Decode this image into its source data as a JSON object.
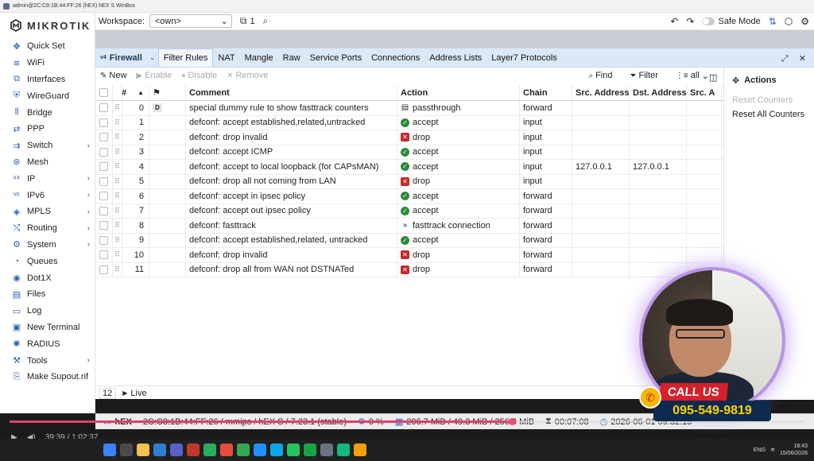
{
  "window": {
    "title": "admin@2C:C8:1B:44:FF:26 (hEX) hEX S WinBox"
  },
  "brand": {
    "logo_text": "MIKROTIK"
  },
  "sidebar": {
    "items": [
      {
        "label": "Quick Set",
        "icon": "quick-set-icon",
        "glyph": "✥",
        "chevron": false
      },
      {
        "label": "WiFi",
        "icon": "wifi-icon",
        "glyph": "≋",
        "chevron": false
      },
      {
        "label": "Interfaces",
        "icon": "interfaces-icon",
        "glyph": "⧉",
        "chevron": false
      },
      {
        "label": "WireGuard",
        "icon": "wireguard-icon",
        "glyph": "⛨",
        "chevron": false
      },
      {
        "label": "Bridge",
        "icon": "bridge-icon",
        "glyph": "⫴",
        "chevron": false
      },
      {
        "label": "PPP",
        "icon": "ppp-icon",
        "glyph": "⇄",
        "chevron": false
      },
      {
        "label": "Switch",
        "icon": "switch-icon",
        "glyph": "⇉",
        "chevron": true
      },
      {
        "label": "Mesh",
        "icon": "mesh-icon",
        "glyph": "⊛",
        "chevron": false
      },
      {
        "label": "IP",
        "icon": "ip-icon",
        "glyph": "ᵛ⁴",
        "chevron": true
      },
      {
        "label": "IPv6",
        "icon": "ipv6-icon",
        "glyph": "ᵛ⁶",
        "chevron": true
      },
      {
        "label": "MPLS",
        "icon": "mpls-icon",
        "glyph": "◈",
        "chevron": true
      },
      {
        "label": "Routing",
        "icon": "routing-icon",
        "glyph": "⤭",
        "chevron": true
      },
      {
        "label": "System",
        "icon": "system-icon",
        "glyph": "⚙",
        "chevron": true
      },
      {
        "label": "Queues",
        "icon": "queues-icon",
        "glyph": "◔",
        "chevron": false
      },
      {
        "label": "Dot1X",
        "icon": "dot1x-icon",
        "glyph": "◉",
        "chevron": false
      },
      {
        "label": "Files",
        "icon": "files-icon",
        "glyph": "▤",
        "chevron": false
      },
      {
        "label": "Log",
        "icon": "log-icon",
        "glyph": "▭",
        "chevron": false
      },
      {
        "label": "New Terminal",
        "icon": "terminal-icon",
        "glyph": "▣",
        "chevron": false
      },
      {
        "label": "RADIUS",
        "icon": "radius-icon",
        "glyph": "✺",
        "chevron": false
      },
      {
        "label": "Tools",
        "icon": "tools-icon",
        "glyph": "⚒",
        "chevron": true
      },
      {
        "label": "Make Supout.rif",
        "icon": "supout-icon",
        "glyph": "⎘",
        "chevron": false
      }
    ]
  },
  "topbar": {
    "workspace_label": "Workspace:",
    "workspace_value": "<own>",
    "windows_count": "1",
    "safe_mode_label": "Safe Mode"
  },
  "firewall": {
    "title": "Firewall",
    "tabs": [
      "Filter Rules",
      "NAT",
      "Mangle",
      "Raw",
      "Service Ports",
      "Connections",
      "Address Lists",
      "Layer7 Protocols"
    ],
    "active_tab": "Filter Rules",
    "toolbar": {
      "new_label": "New",
      "enable_label": "Enable",
      "disable_label": "Disable",
      "remove_label": "Remove",
      "find_label": "Find",
      "filter_label": "Filter",
      "all_label": "all"
    },
    "columns": {
      "num": "#",
      "comment": "Comment",
      "action": "Action",
      "chain": "Chain",
      "src": "Src. Address",
      "dst": "Dst. Address",
      "srcp": "Src. A"
    },
    "rows": [
      {
        "num": "0",
        "flag": "D",
        "comment": "special dummy rule to show fasttrack counters",
        "action": "passthrough",
        "action_type": "passthrough",
        "chain": "forward",
        "src": "",
        "dst": ""
      },
      {
        "num": "1",
        "flag": "",
        "comment": "defconf: accept established,related,untracked",
        "action": "accept",
        "action_type": "accept",
        "chain": "input",
        "src": "",
        "dst": ""
      },
      {
        "num": "2",
        "flag": "",
        "comment": "defconf: drop invalid",
        "action": "drop",
        "action_type": "drop",
        "chain": "input",
        "src": "",
        "dst": ""
      },
      {
        "num": "3",
        "flag": "",
        "comment": "defconf: accept ICMP",
        "action": "accept",
        "action_type": "accept",
        "chain": "input",
        "src": "",
        "dst": ""
      },
      {
        "num": "4",
        "flag": "",
        "comment": "defconf: accept to local loopback (for CAPsMAN)",
        "action": "accept",
        "action_type": "accept",
        "chain": "input",
        "src": "127.0.0.1",
        "dst": "127.0.0.1"
      },
      {
        "num": "5",
        "flag": "",
        "comment": "defconf: drop all not coming from LAN",
        "action": "drop",
        "action_type": "drop",
        "chain": "input",
        "src": "",
        "dst": ""
      },
      {
        "num": "6",
        "flag": "",
        "comment": "defconf: accept in ipsec policy",
        "action": "accept",
        "action_type": "accept",
        "chain": "forward",
        "src": "",
        "dst": ""
      },
      {
        "num": "7",
        "flag": "",
        "comment": "defconf: accept out ipsec policy",
        "action": "accept",
        "action_type": "accept",
        "chain": "forward",
        "src": "",
        "dst": ""
      },
      {
        "num": "8",
        "flag": "",
        "comment": "defconf: fasttrack",
        "action": "fasttrack connection",
        "action_type": "fasttrack",
        "chain": "forward",
        "src": "",
        "dst": ""
      },
      {
        "num": "9",
        "flag": "",
        "comment": "defconf: accept established,related, untracked",
        "action": "accept",
        "action_type": "accept",
        "chain": "forward",
        "src": "",
        "dst": ""
      },
      {
        "num": "10",
        "flag": "",
        "comment": "defconf: drop invalid",
        "action": "drop",
        "action_type": "drop",
        "chain": "forward",
        "src": "",
        "dst": ""
      },
      {
        "num": "11",
        "flag": "",
        "comment": "defconf: drop all from WAN not DSTNATed",
        "action": "drop",
        "action_type": "drop",
        "chain": "forward",
        "src": "",
        "dst": ""
      }
    ],
    "footer": {
      "count": "12",
      "live_label": "Live"
    },
    "actions_panel": {
      "title": "Actions",
      "reset_counters": "Reset Counters",
      "reset_all_counters": "Reset All Counters"
    }
  },
  "statusbar": {
    "device": "hEX",
    "identity": "2C:C8:1B:44:FF:26 / mmips / hEX S / 7.23.1 (stable)",
    "cpu": "0 %",
    "memory": "206.7 MiB / 49.3 MiB / 256.0 MiB",
    "uptime": "00:07:08",
    "datetime": "2026-06-01 09:32:13"
  },
  "video": {
    "time": "39:39 / 1:02:37",
    "progress_fraction": 0.632
  },
  "overlay": {
    "call_us": "CALL US",
    "phone": "095-549-9819"
  },
  "taskbar": {
    "lang": "ENG",
    "clock_time": "18:43",
    "clock_date": "15/06/2026"
  },
  "colors": {
    "accent": "#2c65b0",
    "tab_bar": "#dbe8f6",
    "accept": "#2c8a3c",
    "drop": "#c62b2b",
    "progress": "#e0406a",
    "call_red": "#d6202a",
    "phone_bg": "#0e2a4f",
    "phone_text": "#ffd400"
  }
}
